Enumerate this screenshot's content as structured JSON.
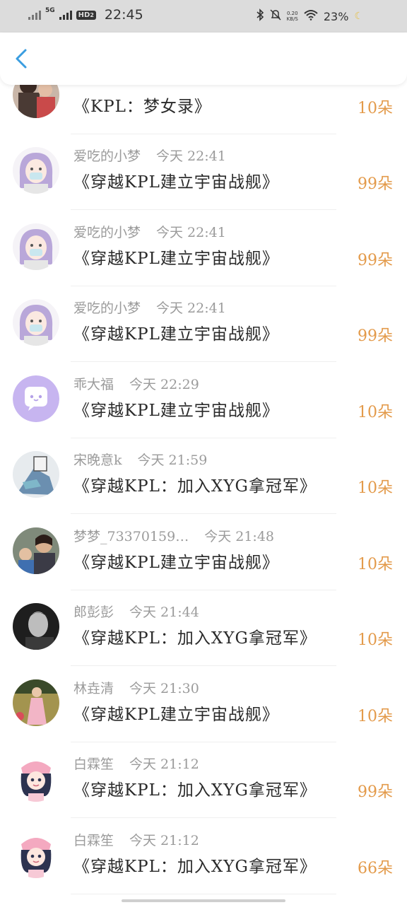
{
  "status_bar": {
    "network": "5G",
    "hd": "HD",
    "hd_sub": "2",
    "time": "22:45",
    "speed_value": "0.20",
    "speed_unit": "KB/S",
    "battery": "23%"
  },
  "header": {
    "back_icon": "chevron-left-icon",
    "accent": "#3a9de0"
  },
  "items": [
    {
      "name": "",
      "time": "",
      "title": "《KPL：梦女录》",
      "amount": "10朵",
      "avatar": "photo-couple"
    },
    {
      "name": "爱吃的小梦",
      "time": "今天 22:41",
      "title": "《穿越KPL建立宇宙战舰》",
      "amount": "99朵",
      "avatar": "anime-purple-hair"
    },
    {
      "name": "爱吃的小梦",
      "time": "今天 22:41",
      "title": "《穿越KPL建立宇宙战舰》",
      "amount": "99朵",
      "avatar": "anime-purple-hair"
    },
    {
      "name": "爱吃的小梦",
      "time": "今天 22:41",
      "title": "《穿越KPL建立宇宙战舰》",
      "amount": "99朵",
      "avatar": "anime-purple-hair"
    },
    {
      "name": "乖大福",
      "time": "今天 22:29",
      "title": "《穿越KPL建立宇宙战舰》",
      "amount": "10朵",
      "avatar": "purple-chat-bubble"
    },
    {
      "name": "宋晚意k",
      "time": "今天 21:59",
      "title": "《穿越KPL：加入XYG拿冠军》",
      "amount": "10朵",
      "avatar": "cartoon-blue"
    },
    {
      "name": "梦梦_73370159…",
      "time": "今天 21:48",
      "title": "《穿越KPL建立宇宙战舰》",
      "amount": "10朵",
      "avatar": "photo-mother-child"
    },
    {
      "name": "郎彭彭",
      "time": "今天 21:44",
      "title": "《穿越KPL：加入XYG拿冠军》",
      "amount": "10朵",
      "avatar": "photo-bw-man"
    },
    {
      "name": "林垚清",
      "time": "今天 21:30",
      "title": "《穿越KPL建立宇宙战舰》",
      "amount": "10朵",
      "avatar": "photo-pink-dress"
    },
    {
      "name": "白霖笙",
      "time": "今天 21:12",
      "title": "《穿越KPL：加入XYG拿冠军》",
      "amount": "99朵",
      "avatar": "anime-pink-girl"
    },
    {
      "name": "白霖笙",
      "time": "今天 21:12",
      "title": "《穿越KPL：加入XYG拿冠军》",
      "amount": "66朵",
      "avatar": "anime-pink-girl"
    }
  ]
}
